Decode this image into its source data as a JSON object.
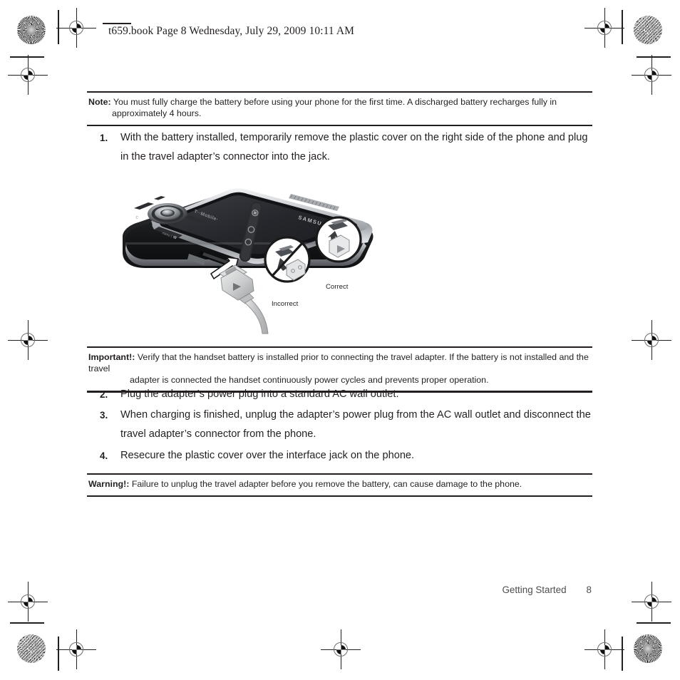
{
  "document": {
    "header_line": "t659.book  Page 8  Wednesday, July 29, 2009  10:11 AM"
  },
  "note_block": {
    "label": "Note:",
    "line1": "You must fully charge the battery before using your phone for the first time. A discharged battery recharges fully in",
    "line2": "approximately 4 hours."
  },
  "important_block": {
    "label": "Important!:",
    "line1": "Verify that the handset battery is installed prior to connecting the travel adapter. If the battery is not installed and the travel",
    "line2": "adapter is connected the handset continuously power cycles and prevents proper operation."
  },
  "warning_block": {
    "label": "Warning!:",
    "line1": "Failure to unplug the travel adapter before you remove the battery, can cause damage to the phone."
  },
  "steps": [
    {
      "number": "1.",
      "text": "With the battery installed, temporarily remove the plastic cover on the right side of the phone and plug in the travel adapter’s connector into the jack."
    },
    {
      "number": "2.",
      "text": "Plug the adapter’s power plug into a standard AC wall outlet."
    },
    {
      "number": "3.",
      "text": "When charging is finished, unplug the adapter’s power plug from the AC wall outlet and disconnect the travel adapter’s connector from the phone."
    },
    {
      "number": "4.",
      "text": "Resecure the plastic cover over the interface jack on the phone."
    }
  ],
  "illustration": {
    "alt": "Samsung slider phone with travel adapter USB connector being inserted into the side interface jack",
    "brand_display": "SAMSUNG",
    "brand_keypad": "T··Mobile·",
    "label_incorrect": "Incorrect",
    "label_correct": "Correct"
  },
  "footer": {
    "section": "Getting Started",
    "page_number": "8"
  },
  "colors": {
    "text": "#231f20",
    "rule": "#231f20",
    "footer_text": "#4d4d4f",
    "phone_body_dark": "#1b1b1d",
    "phone_body_mid": "#3a3a3e",
    "phone_chrome": "#b9bcc0",
    "screen": "#2a2b30",
    "cable_grey": "#c9cacb"
  }
}
